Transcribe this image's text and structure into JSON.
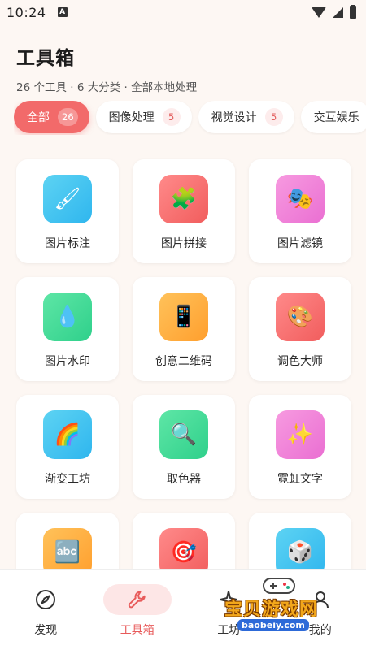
{
  "status_bar": {
    "time": "10:24",
    "notification_letter": "A"
  },
  "header": {
    "title": "工具箱",
    "subtitle": "26 个工具 · 6 大分类 · 全部本地处理"
  },
  "tabs": [
    {
      "label": "全部",
      "count": "26",
      "active": true
    },
    {
      "label": "图像处理",
      "count": "5",
      "active": false
    },
    {
      "label": "视觉设计",
      "count": "5",
      "active": false
    },
    {
      "label": "交互娱乐",
      "count": "",
      "active": false
    }
  ],
  "tools": [
    {
      "label": "图片标注",
      "icon": "paintbrush-icon",
      "glyph": "🖌",
      "color": "#2fb6ee"
    },
    {
      "label": "图片拼接",
      "icon": "puzzle-icon",
      "glyph": "🧩",
      "color": "#f15d5d"
    },
    {
      "label": "图片滤镜",
      "icon": "masks-icon",
      "glyph": "🎭",
      "color": "#ea6fd2"
    },
    {
      "label": "图片水印",
      "icon": "droplet-icon",
      "glyph": "💧",
      "color": "#2fd08b"
    },
    {
      "label": "创意二维码",
      "icon": "phone-icon",
      "glyph": "📱",
      "color": "#ff9f2e"
    },
    {
      "label": "调色大师",
      "icon": "palette-icon",
      "glyph": "🎨",
      "color": "#f15d5d"
    },
    {
      "label": "渐变工坊",
      "icon": "rainbow-icon",
      "glyph": "🌈",
      "color": "#2fb6ee"
    },
    {
      "label": "取色器",
      "icon": "magnifier-icon",
      "glyph": "🔍",
      "color": "#2fd08b"
    },
    {
      "label": "霓虹文字",
      "icon": "sparkles-icon",
      "glyph": "✨",
      "color": "#ea6fd2"
    },
    {
      "label": "",
      "icon": "abc-icon",
      "glyph": "🔤",
      "color": "#ff9f2e"
    },
    {
      "label": "",
      "icon": "target-icon",
      "glyph": "🎯",
      "color": "#f15d5d"
    },
    {
      "label": "",
      "icon": "dice-icon",
      "glyph": "🎲",
      "color": "#2fb6ee"
    }
  ],
  "bottom_nav": [
    {
      "label": "发现",
      "icon": "compass-icon",
      "active": false
    },
    {
      "label": "工具箱",
      "icon": "wrench-icon",
      "active": true
    },
    {
      "label": "工坊",
      "icon": "sparkle-icon",
      "active": false
    },
    {
      "label": "我的",
      "icon": "user-icon",
      "active": false
    }
  ],
  "watermark": {
    "text": "宝贝游戏网",
    "url": "baobeiy.com"
  },
  "colors": {
    "accent": "#f26a6a",
    "background": "#fdf7f3"
  }
}
